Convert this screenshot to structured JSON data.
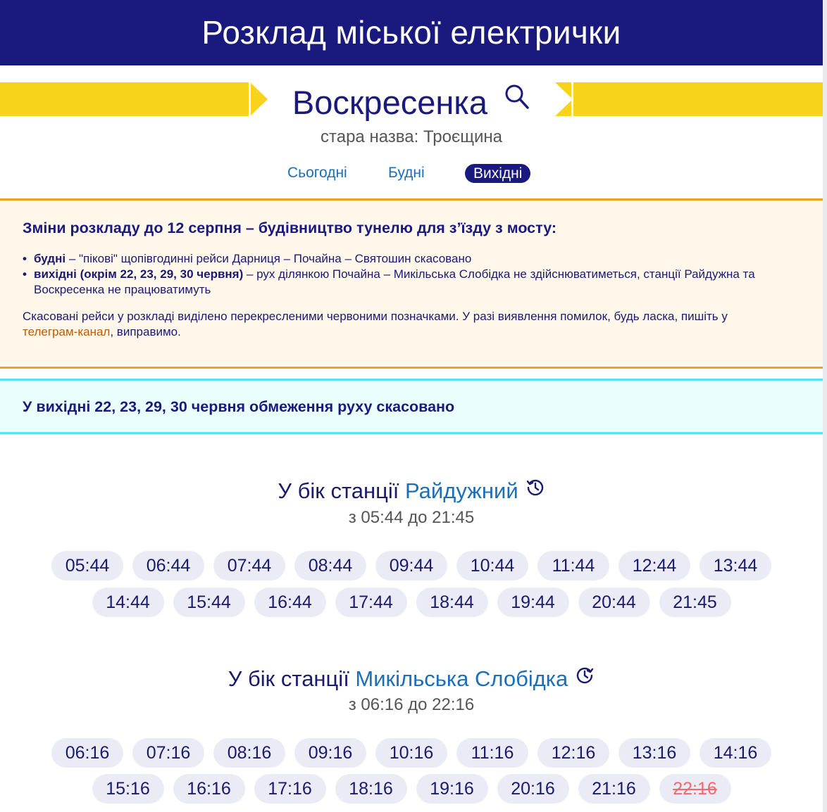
{
  "header": {
    "title": "Розклад міської електрички"
  },
  "station": {
    "name": "Воскресенка",
    "old_name": "стара назва: Троєщина",
    "search_icon": "search-icon"
  },
  "tabs": [
    {
      "label": "Сьогодні",
      "active": false
    },
    {
      "label": "Будні",
      "active": false
    },
    {
      "label": "Вихідні",
      "active": true
    }
  ],
  "notice": {
    "title": "Зміни розкладу до 12 серпня – будівництво тунелю для з’їзду з мосту:",
    "items": [
      {
        "bold": "будні",
        "text": " – \"пікові\" щопівгодинні рейси Дарниця – Почайна – Святошин скасовано"
      },
      {
        "bold": "вихідні (окрім 22, 23, 29, 30 червня)",
        "text": " – рух ділянкою Почайна – Микільська Слобідка не здійснюватиметься, станції Райдужна та Воскресенка не працюватимуть"
      }
    ],
    "para_before": "Скасовані рейси у розкладі виділено перекресленими червоними позначками. У разі виявлення помилок, будь ласка, пишіть у ",
    "link": "телеграм-канал",
    "para_after": ", виправимо."
  },
  "info": {
    "text": "У вихідні 22, 23, 29, 30 червня обмеження руху скасовано"
  },
  "directions": [
    {
      "prefix": "У бік станції ",
      "destination": "Райдужний",
      "icon": "history-clock-icon",
      "range": "з 05:44 до 21:45",
      "rows": [
        [
          "05:44",
          "06:44",
          "07:44",
          "08:44",
          "09:44",
          "10:44",
          "11:44",
          "12:44",
          "13:44"
        ],
        [
          "14:44",
          "15:44",
          "16:44",
          "17:44",
          "18:44",
          "19:44",
          "20:44",
          "21:45"
        ]
      ],
      "cancelled": []
    },
    {
      "prefix": "У бік станції ",
      "destination": "Микільська Слобідка",
      "icon": "clock-forward-icon",
      "range": "з 06:16 до 22:16",
      "rows": [
        [
          "06:16",
          "07:16",
          "08:16",
          "09:16",
          "10:16",
          "11:16",
          "12:16",
          "13:16",
          "14:16"
        ],
        [
          "15:16",
          "16:16",
          "17:16",
          "18:16",
          "19:16",
          "20:16",
          "21:16",
          "22:16"
        ]
      ],
      "cancelled": [
        "22:16"
      ]
    }
  ],
  "colors": {
    "header_bg": "#1a1a7e",
    "accent_yellow": "#f7d31c",
    "link_blue": "#1b6fb8",
    "notice_border": "#f0a321",
    "info_border": "#5ee0f0",
    "cancelled": "#f06a6a"
  }
}
